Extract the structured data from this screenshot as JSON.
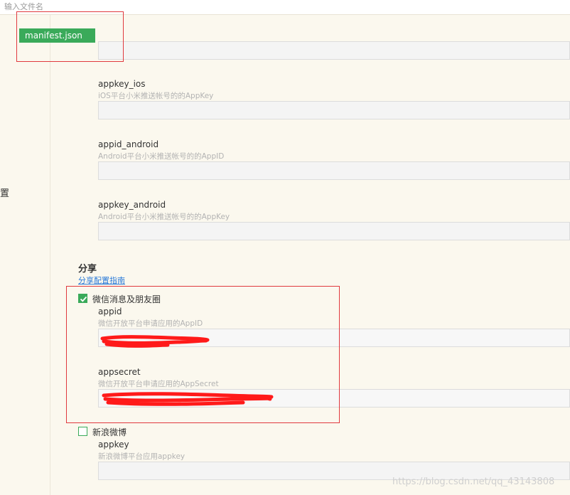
{
  "search": {
    "placeholder": "输入文件名"
  },
  "file_tab": {
    "label": "manifest.json"
  },
  "sidebar": {
    "partial_label": "置"
  },
  "fields_top": [
    {
      "label": "appkey_ios",
      "hint": "iOS平台小米推送帐号的的AppKey"
    },
    {
      "label": "appid_android",
      "hint": "Android平台小米推送帐号的的AppID"
    },
    {
      "label": "appkey_android",
      "hint": "Android平台小米推送帐号的的AppKey"
    }
  ],
  "share": {
    "title": "分享",
    "guide_link": "分享配置指南",
    "wechat": {
      "label": "微信消息及朋友圈",
      "checked": true,
      "appid": {
        "label": "appid",
        "hint": "微信开放平台申请应用的AppID"
      },
      "appsecret": {
        "label": "appsecret",
        "hint": "微信开放平台申请应用的AppSecret"
      }
    },
    "weibo": {
      "label": "新浪微博",
      "checked": false,
      "appkey": {
        "label": "appkey",
        "hint": "新浪微博平台应用appkey"
      }
    }
  },
  "watermark": "https://blog.csdn.net/qq_43143808",
  "colors": {
    "accent": "#3aaa5a",
    "highlight": "#e0393e",
    "link": "#2a7ad8",
    "scribble": "#ff1a1a"
  }
}
